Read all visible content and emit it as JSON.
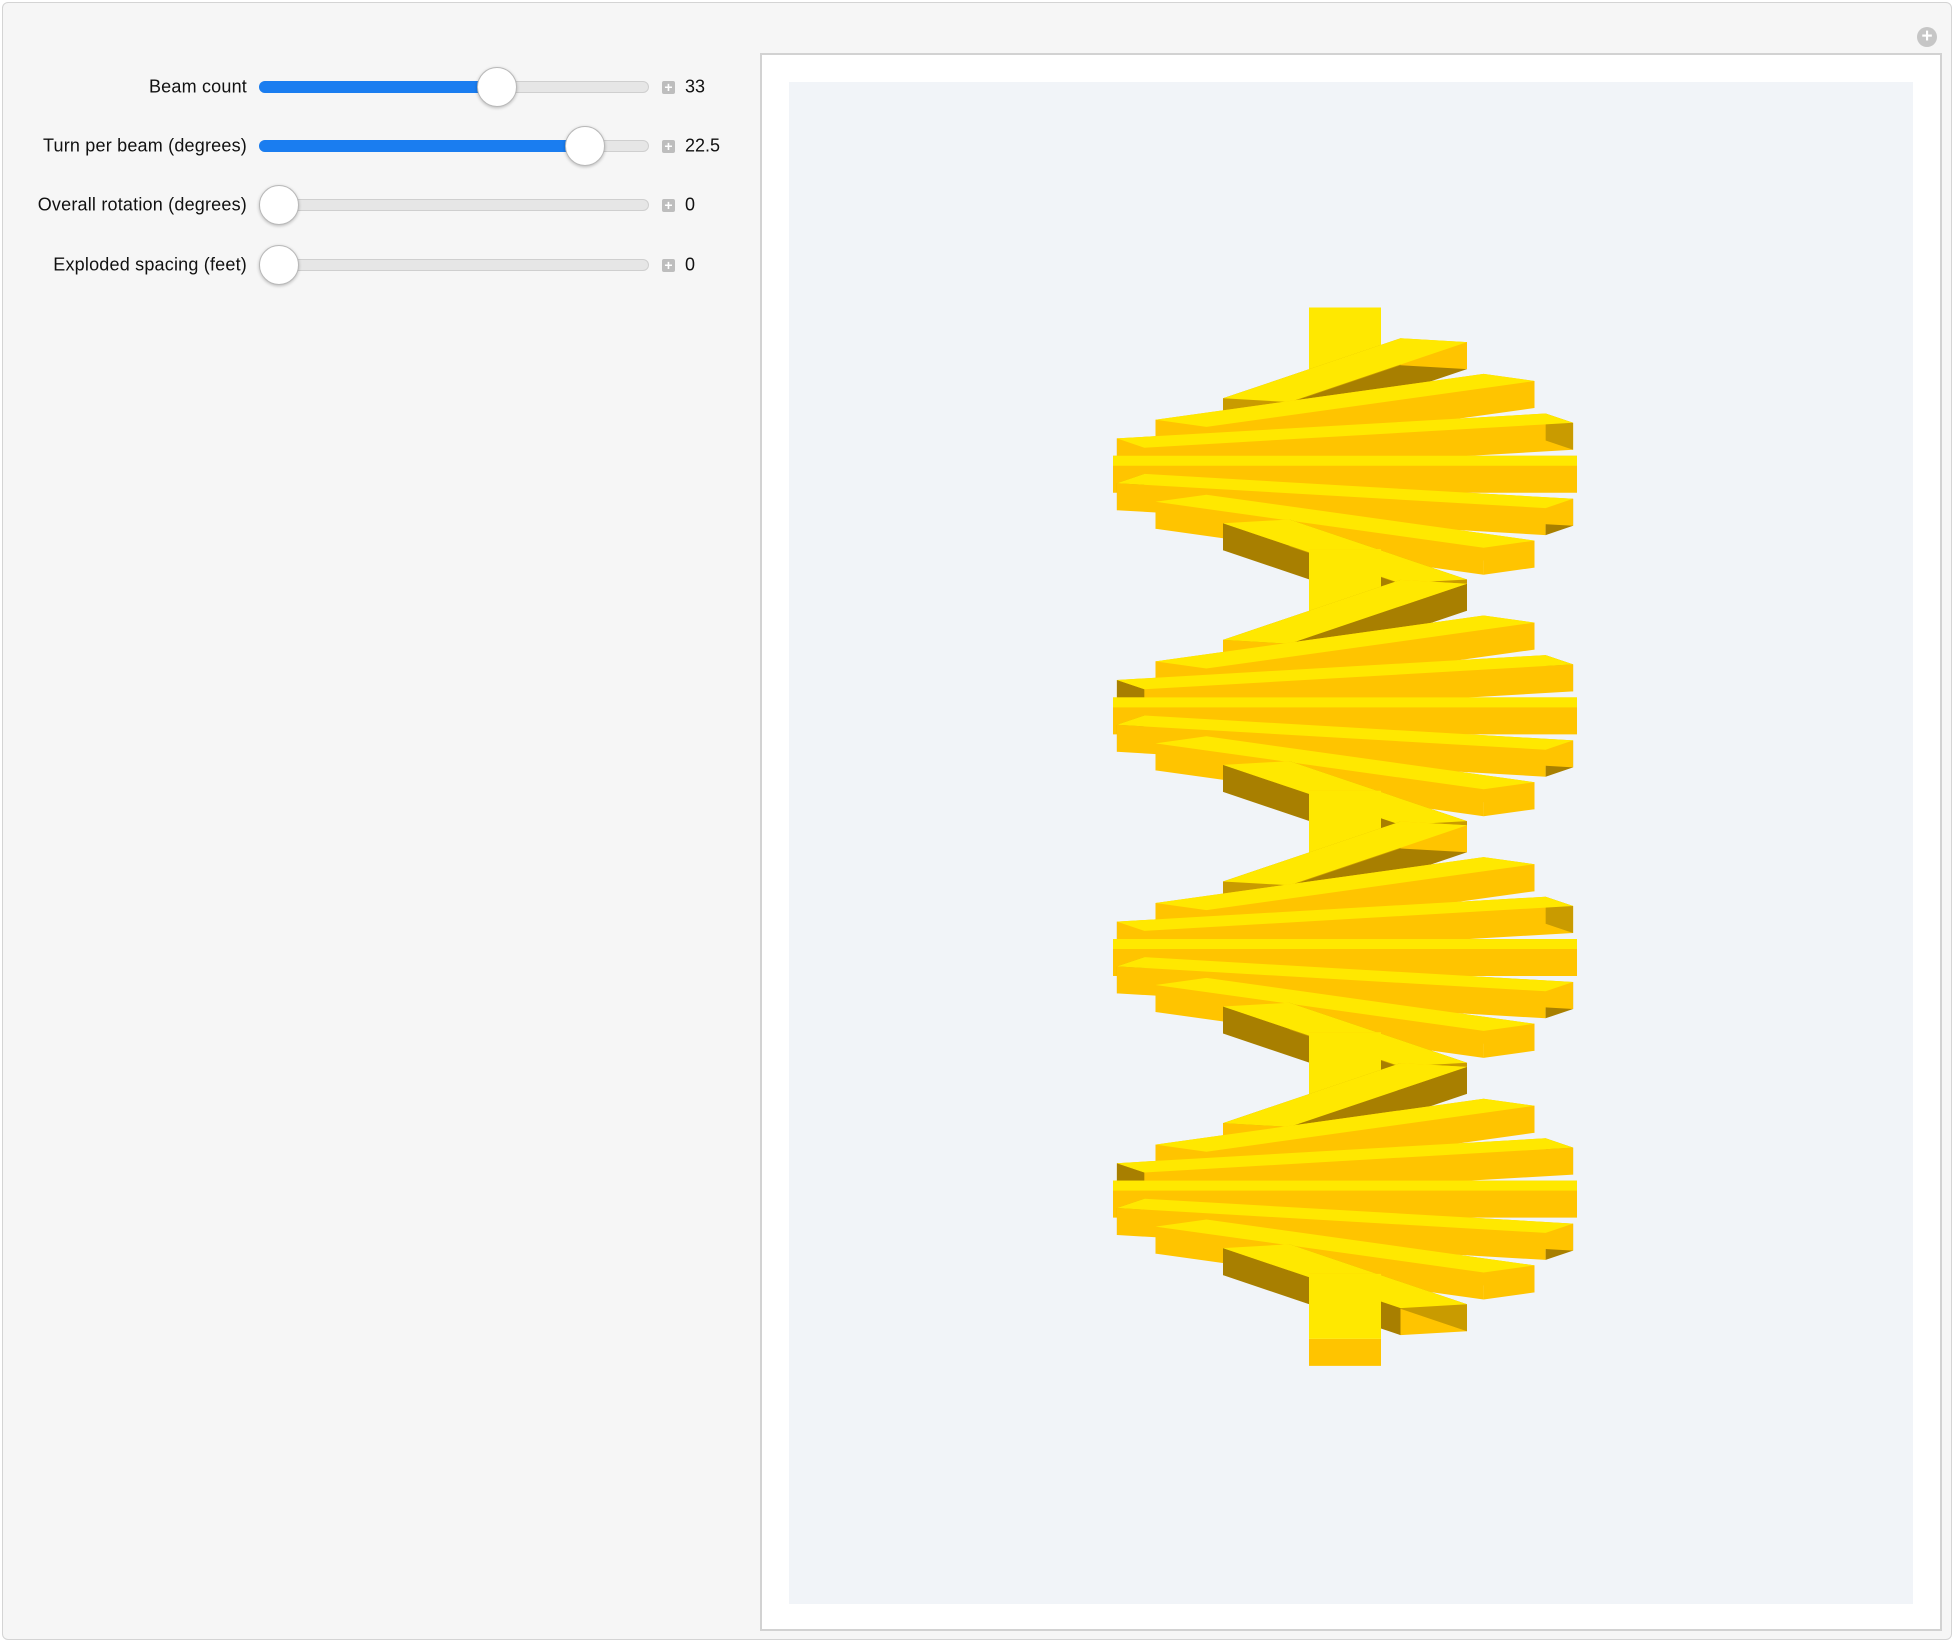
{
  "controls": [
    {
      "label": "Beam count",
      "value": "33",
      "fraction": 0.61,
      "filled": true
    },
    {
      "label": "Turn per beam (degrees)",
      "value": "22.5",
      "fraction": 0.835,
      "filled": true
    },
    {
      "label": "Overall rotation (degrees)",
      "value": "0",
      "fraction": 0.05,
      "filled": false
    },
    {
      "label": "Exploded spacing (feet)",
      "value": "0",
      "fraction": 0.05,
      "filled": false
    }
  ],
  "colors": {
    "slider_fill": "#1a7df0",
    "beam_top": "#ffe800",
    "beam_front": "#ffc400",
    "beam_side": "#c99b00",
    "beam_dark": "#a87f00",
    "background": "#f1f4f8"
  },
  "icons": {
    "expand": "plus-circle-icon",
    "stepper": "plus-icon"
  }
}
